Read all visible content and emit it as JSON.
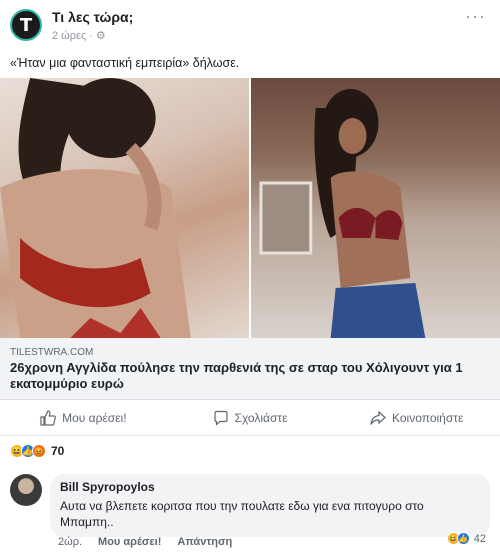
{
  "post": {
    "page_name": "Τι λες τώρα;",
    "avatar_letter": "T",
    "time": "2 ώρες",
    "privacy_icon": "gear-icon",
    "text": "«Ήταν μια φανταστική εμπειρία» δήλωσε."
  },
  "link": {
    "domain": "TILESTWRA.COM",
    "title": "26χρονη Αγγλίδα πούλησε την παρθενιά της σε σταρ του Χόλιγουντ για 1 εκατομμύριο ευρώ"
  },
  "actions": {
    "like": "Μου αρέσει!",
    "comment": "Σχολιάστε",
    "share": "Κοινοποιήστε"
  },
  "reactions": {
    "count": "70",
    "types": [
      "haha",
      "like",
      "angry"
    ]
  },
  "comment": {
    "author": "Bill Spyropoylos",
    "text": "Αυτα να βλεπετε κοριτσα που την πουλατε εδω για ενα πιτογυρο στο Μπαμπη..",
    "time": "2ώρ.",
    "like": "Μου αρέσει!",
    "reply": "Απάντηση",
    "reaction_count": "42"
  },
  "colors": {
    "accent": "#1877f2",
    "avatar_ring": "#2fb7a6"
  }
}
